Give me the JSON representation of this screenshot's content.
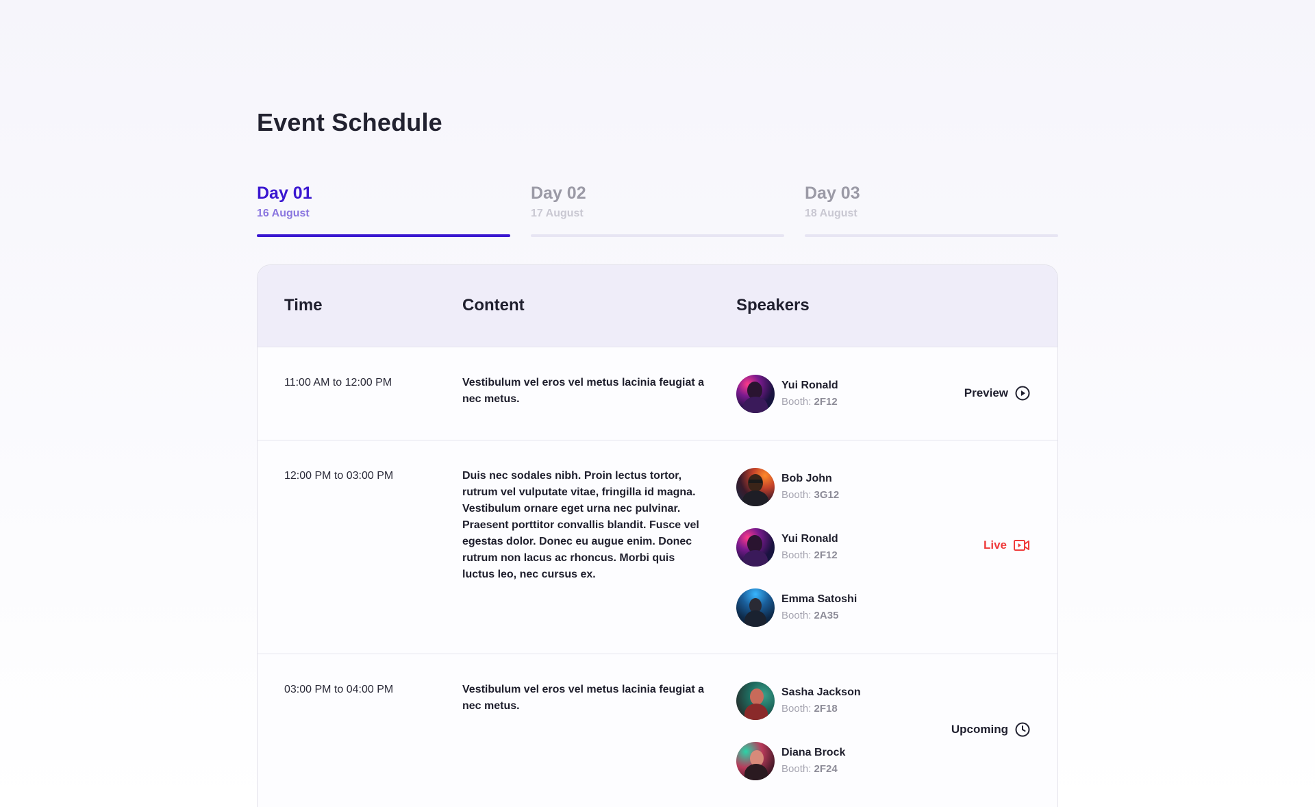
{
  "page_title": "Event Schedule",
  "tabs": [
    {
      "label": "Day 01",
      "date": "16 August",
      "active": true
    },
    {
      "label": "Day 02",
      "date": "17 August",
      "active": false
    },
    {
      "label": "Day 03",
      "date": "18 August",
      "active": false
    }
  ],
  "table": {
    "headers": {
      "time": "Time",
      "content": "Content",
      "speakers": "Speakers"
    },
    "rows": [
      {
        "time": "11:00 AM to 12:00 PM",
        "content": "Vestibulum vel eros vel metus lacinia feugiat a nec metus.",
        "speakers": [
          {
            "name": "Yui Ronald",
            "booth_label": "Booth:",
            "booth": "2F12"
          }
        ],
        "status": {
          "label": "Preview",
          "icon": "play-circle-icon",
          "color": "#1f1f2e"
        }
      },
      {
        "time": "12:00 PM to 03:00 PM",
        "content": "Duis nec sodales nibh. Proin lectus tortor, rutrum vel vulputate vitae, fringilla id magna. Vestibulum ornare eget urna nec pulvinar. Praesent porttitor convallis blandit. Fusce vel egestas dolor. Donec eu augue enim. Donec rutrum non lacus ac rhoncus. Morbi quis luctus leo, nec cursus ex.",
        "speakers": [
          {
            "name": "Bob John",
            "booth_label": "Booth:",
            "booth": "3G12"
          },
          {
            "name": "Yui Ronald",
            "booth_label": "Booth:",
            "booth": "2F12"
          },
          {
            "name": "Emma Satoshi",
            "booth_label": "Booth:",
            "booth": "2A35"
          }
        ],
        "status": {
          "label": "Live",
          "icon": "video-camera-icon",
          "color": "#ef3b3b"
        }
      },
      {
        "time": "03:00 PM to 04:00 PM",
        "content": "Vestibulum vel eros vel metus lacinia feugiat a nec metus.",
        "speakers": [
          {
            "name": "Sasha Jackson",
            "booth_label": "Booth:",
            "booth": "2F18"
          },
          {
            "name": "Diana Brock",
            "booth_label": "Booth:",
            "booth": "2F24"
          }
        ],
        "status": {
          "label": "Upcoming",
          "icon": "clock-icon",
          "color": "#1f1f2e"
        }
      }
    ]
  },
  "colors": {
    "accent": "#3a17d0",
    "accent_light": "#8a76df",
    "header_bg": "#efedf9",
    "live": "#ef3b3b"
  }
}
